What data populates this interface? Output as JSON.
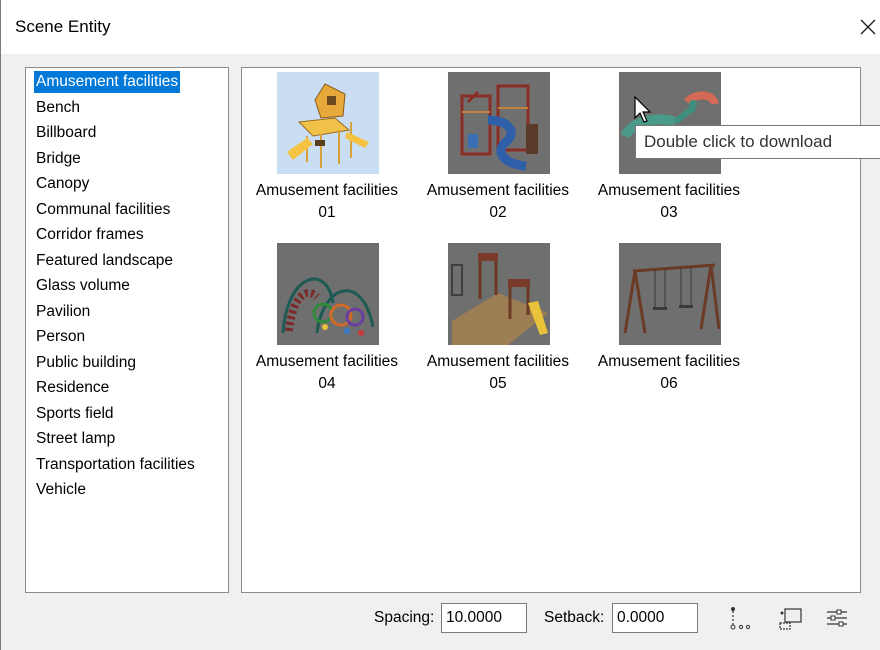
{
  "window": {
    "title": "Scene Entity"
  },
  "categories": [
    "Amusement facilities",
    "Bench",
    "Billboard",
    "Bridge",
    "Canopy",
    "Communal facilities",
    "Corridor frames",
    "Featured landscape",
    "Glass volume",
    "Pavilion",
    "Person",
    "Public building",
    "Residence",
    "Sports field",
    "Street lamp",
    "Transportation facilities",
    "Vehicle"
  ],
  "selected_category": "Amusement facilities",
  "items": [
    {
      "line1": "Amusement facilities",
      "line2": "01"
    },
    {
      "line1": "Amusement facilities",
      "line2": "02"
    },
    {
      "line1": "Amusement facilities",
      "line2": "03"
    },
    {
      "line1": "Amusement facilities",
      "line2": "04"
    },
    {
      "line1": "Amusement facilities",
      "line2": "05"
    },
    {
      "line1": "Amusement facilities",
      "line2": "06"
    }
  ],
  "tooltip": "Double click to download",
  "footer": {
    "spacing_label": "Spacing:",
    "spacing_value": "10.0000",
    "setback_label": "Setback:",
    "setback_value": "0.0000"
  },
  "colors": {
    "selection": "#0078d7",
    "window_bg": "#f0f0f0",
    "thumb_bg": "#6f6f6f",
    "thumb_bg_selected": "#c9ddf3"
  }
}
